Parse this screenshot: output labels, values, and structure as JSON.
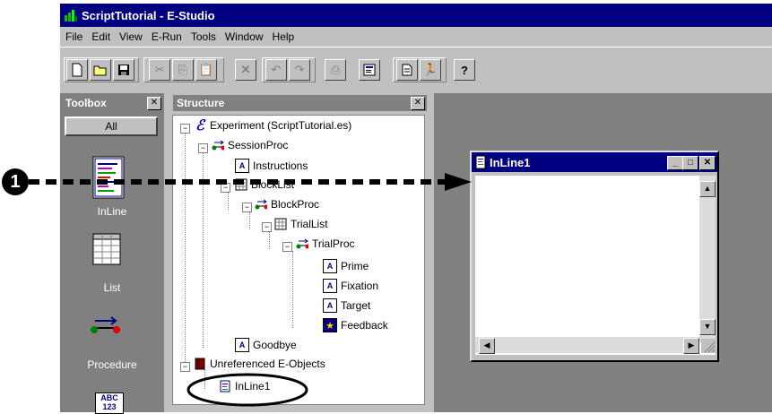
{
  "window": {
    "title": "ScriptTutorial - E-Studio"
  },
  "menu": [
    "File",
    "Edit",
    "View",
    "E-Run",
    "Tools",
    "Window",
    "Help"
  ],
  "toolbar_icons": [
    "new-icon",
    "open-icon",
    "save-icon",
    "cut-icon",
    "copy-icon",
    "paste-icon",
    "delete-icon",
    "undo-icon",
    "redo-icon",
    "print-icon",
    "properties-icon",
    "script-icon",
    "run-icon",
    "help-icon"
  ],
  "toolbox": {
    "title": "Toolbox",
    "all_label": "All",
    "items": [
      {
        "label": "InLine"
      },
      {
        "label": "List"
      },
      {
        "label": "Procedure"
      }
    ]
  },
  "structure": {
    "title": "Structure",
    "nodes": {
      "experiment": "Experiment (ScriptTutorial.es)",
      "session": "SessionProc",
      "instructions": "Instructions",
      "blocklist": "BlockList",
      "blockproc": "BlockProc",
      "triallist": "TrialList",
      "trialproc": "TrialProc",
      "prime": "Prime",
      "fixation": "Fixation",
      "target": "Target",
      "feedback": "Feedback",
      "goodbye": "Goodbye",
      "unref": "Unreferenced E-Objects",
      "inline1": "InLine1"
    }
  },
  "inline_window": {
    "title": "InLine1"
  },
  "callout": {
    "marker": "❶"
  },
  "colors": {
    "titlebar": "#000080",
    "chrome": "#c0c0c0",
    "panel": "#808080"
  }
}
